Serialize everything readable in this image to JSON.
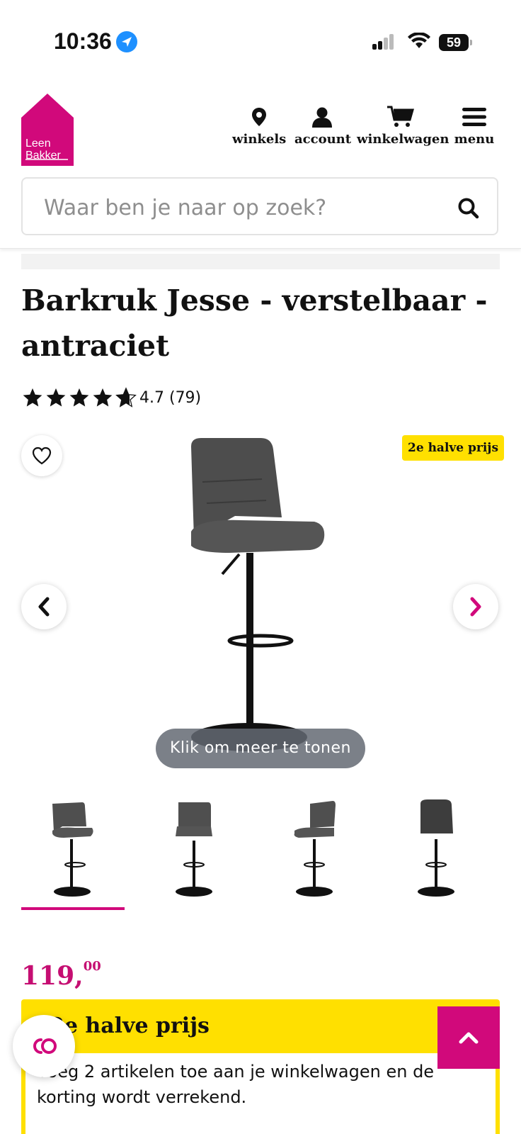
{
  "status_bar": {
    "time": "10:36",
    "battery": "59"
  },
  "brand": {
    "logo_line1": "Leen",
    "logo_line2": "Bakker",
    "accent": "#d1097b",
    "promo_yellow": "#ffe000"
  },
  "nav": [
    {
      "label": "winkels",
      "icon": "location-pin-icon"
    },
    {
      "label": "account",
      "icon": "user-icon"
    },
    {
      "label": "winkelwagen",
      "icon": "cart-icon"
    },
    {
      "label": "menu",
      "icon": "hamburger-icon"
    }
  ],
  "search": {
    "placeholder": "Waar ben je naar op zoek?"
  },
  "product": {
    "title": "Barkruk Jesse - verstelbaar - antraciet",
    "rating_value": 4.7,
    "rating_text": "4.7 (79)",
    "badge": "2e halve prijs",
    "gallery_hint": "Klik om meer te tonen",
    "thumbnail_count": 4,
    "price_main": "119,",
    "price_cents": "00"
  },
  "promo": {
    "title": "2e halve prijs",
    "description": "Voeg 2 artikelen toe aan je winkelwagen en de korting wordt verrekend."
  }
}
